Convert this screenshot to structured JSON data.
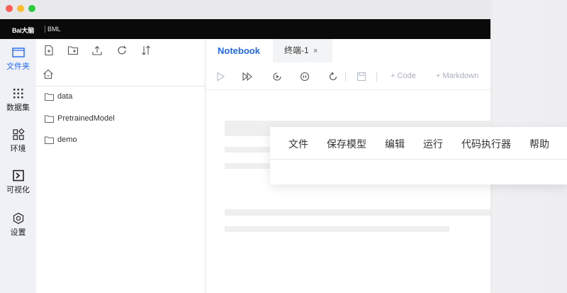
{
  "brand": {
    "logo": "Bai大脑",
    "name": "BML"
  },
  "nav": [
    {
      "id": "files",
      "label": "文件夹",
      "active": true
    },
    {
      "id": "datasets",
      "label": "数据集",
      "active": false
    },
    {
      "id": "environment",
      "label": "环境",
      "active": false
    },
    {
      "id": "visualization",
      "label": "可视化",
      "active": false
    },
    {
      "id": "settings",
      "label": "设置",
      "active": false
    }
  ],
  "file_toolbar": [
    "new-file-icon",
    "new-folder-icon",
    "upload-icon",
    "refresh-icon",
    "sort-icon"
  ],
  "files": [
    {
      "name": "data"
    },
    {
      "name": "PretrainedModel"
    },
    {
      "name": "demo"
    }
  ],
  "tabs": [
    {
      "label": "Notebook",
      "active": true
    },
    {
      "label": "终端-1",
      "close": "×",
      "active": false
    }
  ],
  "notebook_toolbar": {
    "code_label": "+ Code",
    "markdown_label": "+ Markdown"
  },
  "menu": [
    "文件",
    "保存模型",
    "编辑",
    "运行",
    "代码执行器",
    "帮助"
  ],
  "colors": {
    "accent": "#2468f2",
    "brandbar": "#0a0a0a",
    "sidebar": "#eff1f7"
  }
}
